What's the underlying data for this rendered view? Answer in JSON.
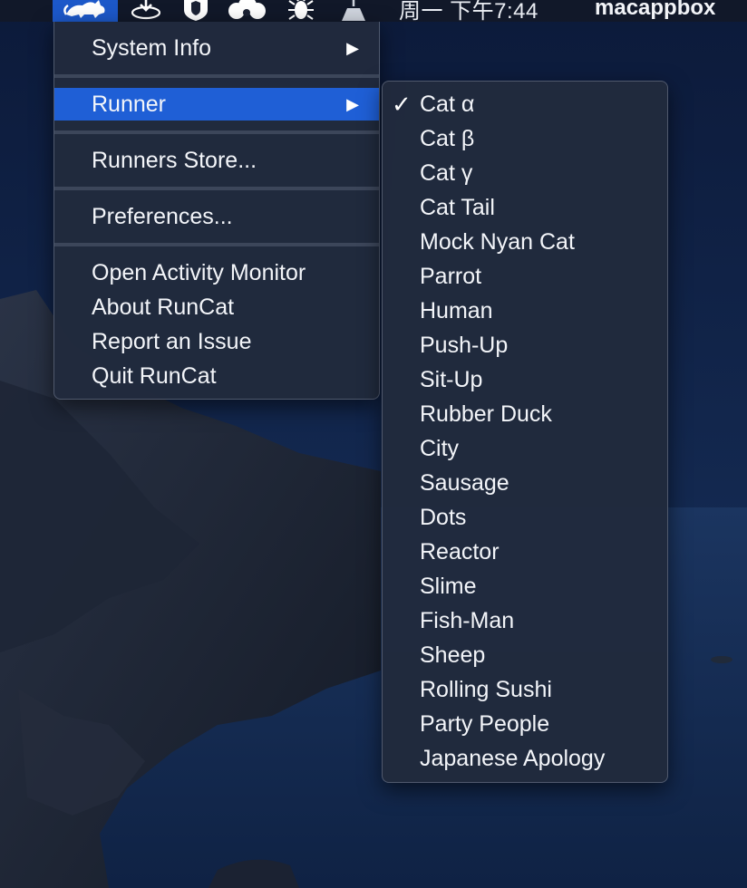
{
  "menubar": {
    "icons": [
      "runcat-cat-icon",
      "download-drive-icon",
      "shield-icon",
      "cloud-icon",
      "cockroach-icon",
      "broom-icon"
    ],
    "clock": "周一 下午7:44",
    "user": "macappbox",
    "highlight_color": "#1c58c9"
  },
  "main_menu": {
    "system_info": "System Info",
    "runner": "Runner",
    "runners_store": "Runners Store...",
    "preferences": "Preferences...",
    "open_activity_monitor": "Open Activity Monitor",
    "about": "About RunCat",
    "report_issue": "Report an Issue",
    "quit": "Quit RunCat",
    "submenu_arrow": "▶"
  },
  "runner_menu": {
    "checkmark": "✓",
    "selected_index": 0,
    "items": [
      "Cat α",
      "Cat β",
      "Cat γ",
      "Cat Tail",
      "Mock Nyan Cat",
      "Parrot",
      "Human",
      "Push-Up",
      "Sit-Up",
      "Rubber Duck",
      "City",
      "Sausage",
      "Dots",
      "Reactor",
      "Slime",
      "Fish-Man",
      "Sheep",
      "Rolling Sushi",
      "Party People",
      "Japanese Apology"
    ]
  },
  "colors": {
    "menu_background": "#212a3d",
    "highlight": "#1f5fd6",
    "text": "#f3f5f9"
  }
}
